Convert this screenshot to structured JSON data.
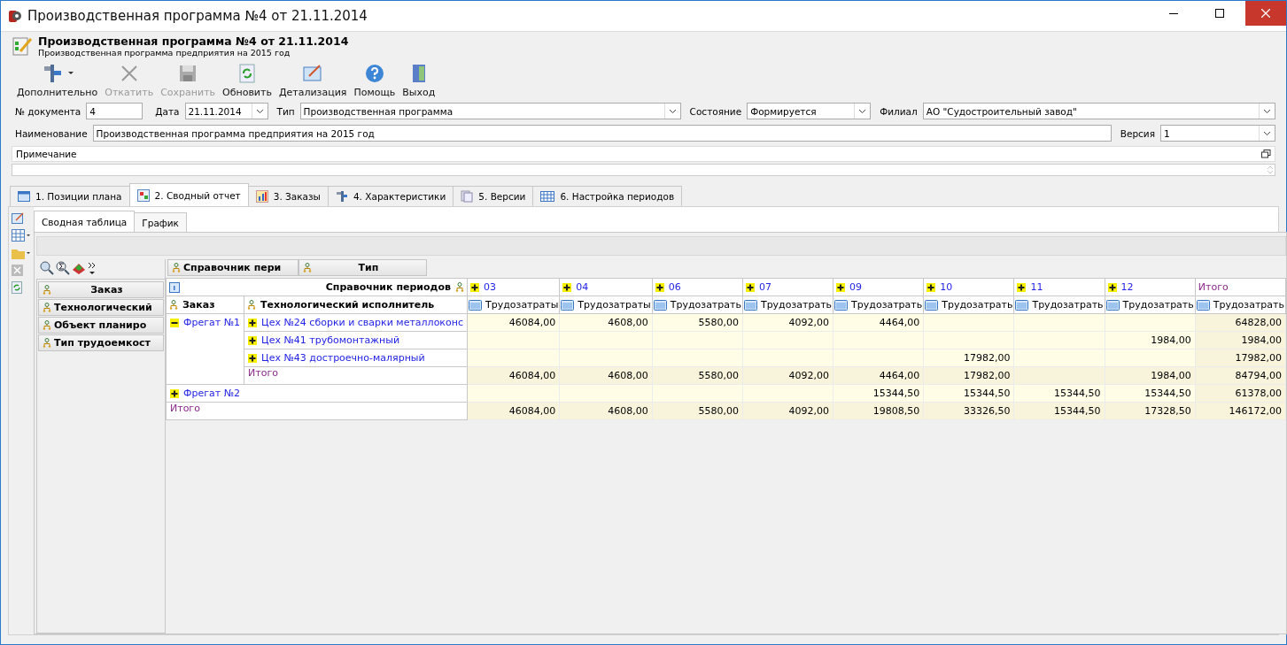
{
  "window": {
    "title": "Производственная программа №4 от 21.11.2014"
  },
  "header": {
    "title": "Производственная программа №4 от 21.11.2014",
    "subtitle": "Производственная программа предприятия на 2015 год"
  },
  "toolbar": [
    {
      "kind": "tools",
      "label": "Дополнительно",
      "disabled": false,
      "dropdown": true
    },
    {
      "kind": "cancel",
      "label": "Откатить",
      "disabled": true,
      "dropdown": false
    },
    {
      "kind": "save",
      "label": "Сохранить",
      "disabled": true,
      "dropdown": false
    },
    {
      "kind": "refresh",
      "label": "Обновить",
      "disabled": false,
      "dropdown": false
    },
    {
      "kind": "detail",
      "label": "Детализация",
      "disabled": false,
      "dropdown": false
    },
    {
      "kind": "help",
      "label": "Помощь",
      "disabled": false,
      "dropdown": false
    },
    {
      "kind": "exit",
      "label": "Выход",
      "disabled": false,
      "dropdown": false
    }
  ],
  "form": {
    "doc_number": {
      "label": "№ документа",
      "value": "4"
    },
    "date": {
      "label": "Дата",
      "value": "21.11.2014"
    },
    "type": {
      "label": "Тип",
      "value": "Производственная программа"
    },
    "state": {
      "label": "Состояние",
      "value": "Формируется"
    },
    "branch": {
      "label": "Филиал",
      "value": "АО \"Судостроительный завод\""
    },
    "name": {
      "label": "Наименование",
      "value": "Производственная программа предприятия на 2015 год"
    },
    "version": {
      "label": "Версия",
      "value": "1"
    },
    "note": {
      "label": "Примечание"
    }
  },
  "tabs": [
    {
      "kind": "list",
      "label": "1. Позиции плана",
      "selected": false
    },
    {
      "kind": "report",
      "label": "2. Сводный отчет",
      "selected": true
    },
    {
      "kind": "chart",
      "label": "3. Заказы",
      "selected": false
    },
    {
      "kind": "tools",
      "label": "4. Характеристики",
      "selected": false
    },
    {
      "kind": "pages",
      "label": "5. Версии",
      "selected": false
    },
    {
      "kind": "grid",
      "label": "6. Настройка периодов",
      "selected": false
    }
  ],
  "subtabs": [
    {
      "label": "Сводная таблица",
      "selected": true
    },
    {
      "label": "График",
      "selected": false
    }
  ],
  "pivot": {
    "filter_fields": [
      "Справочник пери",
      "Тип"
    ],
    "field_list": [
      "Заказ",
      "Технологический",
      "Объект планиро",
      "Тип трудоемкост"
    ],
    "column_area_title": "Справочник периодов",
    "row_headers": [
      "Заказ",
      "Технологический исполнитель"
    ],
    "columns": [
      {
        "kind": "period",
        "label": "03",
        "expanded": false,
        "measure": "Трудозатраты"
      },
      {
        "kind": "period",
        "label": "04",
        "expanded": false,
        "measure": "Трудозатраты"
      },
      {
        "kind": "period",
        "label": "06",
        "expanded": false,
        "measure": "Трудозатрать"
      },
      {
        "kind": "period",
        "label": "07",
        "expanded": false,
        "measure": "Трудозатрать"
      },
      {
        "kind": "period",
        "label": "09",
        "expanded": false,
        "measure": "Трудозатрать"
      },
      {
        "kind": "period",
        "label": "10",
        "expanded": false,
        "measure": "Трудозатрать"
      },
      {
        "kind": "period",
        "label": "11",
        "expanded": false,
        "measure": "Трудозатрать"
      },
      {
        "kind": "period",
        "label": "12",
        "expanded": false,
        "measure": "Трудозатрать"
      },
      {
        "kind": "total",
        "label": "Итого",
        "measure": "Трудозатрать"
      }
    ],
    "groups": [
      {
        "label": "Фрегат №1",
        "expanded": true,
        "children": [
          {
            "label": "Цех №24 сборки и сварки металлоконс",
            "expanded": false,
            "cells": [
              {
                "kind": "value",
                "text": "46084,00"
              },
              {
                "kind": "value",
                "text": "4608,00"
              },
              {
                "kind": "value",
                "text": "5580,00"
              },
              {
                "kind": "value",
                "text": "4092,00"
              },
              {
                "kind": "value",
                "text": "4464,00"
              },
              {
                "kind": "empty"
              },
              {
                "kind": "empty"
              },
              {
                "kind": "empty"
              },
              {
                "kind": "value",
                "text": "64828,00"
              }
            ]
          },
          {
            "label": "Цех №41 трубомонтажный",
            "expanded": false,
            "cells": [
              {
                "kind": "empty"
              },
              {
                "kind": "empty"
              },
              {
                "kind": "empty"
              },
              {
                "kind": "empty"
              },
              {
                "kind": "empty"
              },
              {
                "kind": "empty"
              },
              {
                "kind": "empty"
              },
              {
                "kind": "value",
                "text": "1984,00"
              },
              {
                "kind": "value",
                "text": "1984,00"
              }
            ]
          },
          {
            "label": "Цех №43 достроечно-малярный",
            "expanded": false,
            "cells": [
              {
                "kind": "empty"
              },
              {
                "kind": "empty"
              },
              {
                "kind": "empty"
              },
              {
                "kind": "empty"
              },
              {
                "kind": "empty"
              },
              {
                "kind": "value",
                "text": "17982,00"
              },
              {
                "kind": "empty"
              },
              {
                "kind": "empty"
              },
              {
                "kind": "value",
                "text": "17982,00"
              }
            ]
          }
        ],
        "subtotal": {
          "label": "Итого",
          "cells": [
            {
              "kind": "value",
              "text": "46084,00"
            },
            {
              "kind": "value",
              "text": "4608,00"
            },
            {
              "kind": "value",
              "text": "5580,00"
            },
            {
              "kind": "value",
              "text": "4092,00"
            },
            {
              "kind": "value",
              "text": "4464,00"
            },
            {
              "kind": "value",
              "text": "17982,00"
            },
            {
              "kind": "empty"
            },
            {
              "kind": "value",
              "text": "1984,00"
            },
            {
              "kind": "value",
              "text": "84794,00"
            }
          ]
        }
      },
      {
        "label": "Фрегат №2",
        "expanded": false,
        "cells": [
          {
            "kind": "empty"
          },
          {
            "kind": "empty"
          },
          {
            "kind": "empty"
          },
          {
            "kind": "empty"
          },
          {
            "kind": "value",
            "text": "15344,50"
          },
          {
            "kind": "value",
            "text": "15344,50"
          },
          {
            "kind": "value",
            "text": "15344,50"
          },
          {
            "kind": "value",
            "text": "15344,50"
          },
          {
            "kind": "value",
            "text": "61378,00"
          }
        ]
      }
    ],
    "grand_total": {
      "label": "Итого",
      "cells": [
        {
          "kind": "value",
          "text": "46084,00"
        },
        {
          "kind": "value",
          "text": "4608,00"
        },
        {
          "kind": "value",
          "text": "5580,00"
        },
        {
          "kind": "value",
          "text": "4092,00"
        },
        {
          "kind": "value",
          "text": "19808,50"
        },
        {
          "kind": "value",
          "text": "33326,50"
        },
        {
          "kind": "value",
          "text": "15344,50"
        },
        {
          "kind": "value",
          "text": "17328,50"
        },
        {
          "kind": "value",
          "text": "146172,00"
        }
      ]
    }
  }
}
